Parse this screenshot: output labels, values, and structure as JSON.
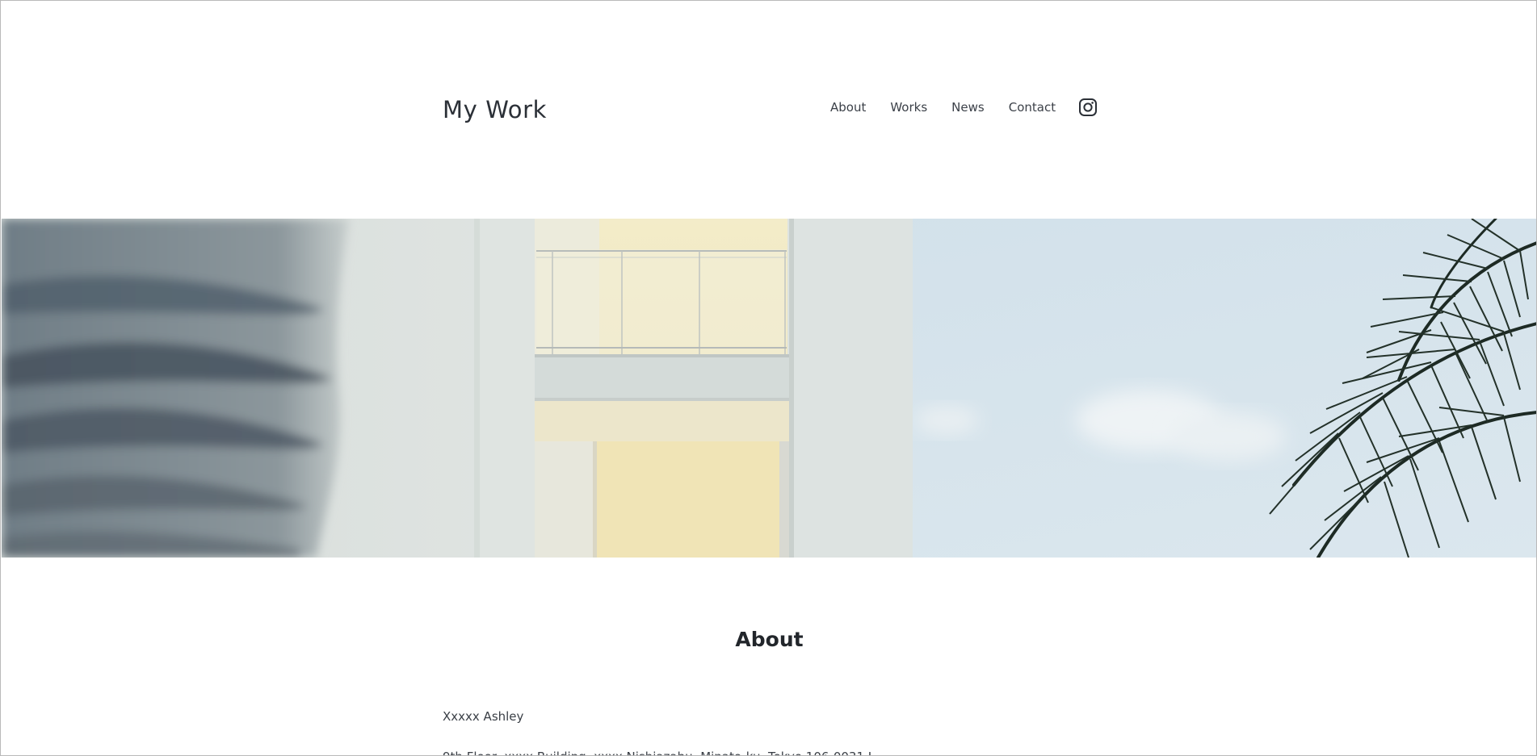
{
  "site": {
    "title": "My Work"
  },
  "nav": {
    "items": [
      "About",
      "Works",
      "News",
      "Contact"
    ],
    "social_icon": "instagram-icon"
  },
  "hero": {
    "image_description_icon": "hero-image"
  },
  "about": {
    "heading": "About",
    "name": "Xxxxx Ashley",
    "address": "9th Floor, xxxx Building, xxxx Nishiazabu, Minato-ku, Tokyo 106-0031 J"
  },
  "colors": {
    "text": "#2b3037",
    "background": "#ffffff",
    "sky": "#d3e2ec",
    "wall": "#e3e8e6",
    "balcony": "#efe6c4"
  }
}
